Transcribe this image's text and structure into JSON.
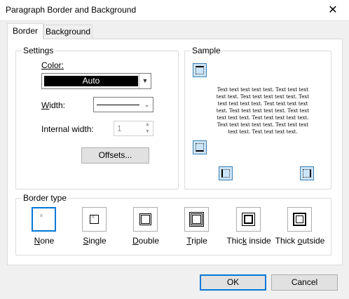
{
  "window": {
    "title": "Paragraph Border and Background",
    "close_glyph": "✕"
  },
  "tabs": [
    {
      "label": "Border",
      "active": true
    },
    {
      "label": "Background",
      "active": false
    }
  ],
  "settings": {
    "group_label": "Settings",
    "color_label": "Color:",
    "color_value": "Auto",
    "width_label": "Width:",
    "internal_width_label": "Internal width:",
    "internal_width_value": "1",
    "offsets_label": "Offsets..."
  },
  "sample": {
    "group_label": "Sample",
    "text": "Text text text text text. Text text text text text. Text text text text text. Text text text text text. Text text text text text. Text text text text text. Text text text text text. Text text text text text. Text text text text text. Text text text text text. Text text text text."
  },
  "border_type": {
    "group_label": "Border type",
    "options": [
      {
        "label": "None",
        "selected": true
      },
      {
        "label": "Single",
        "selected": false
      },
      {
        "label": "Double",
        "selected": false
      },
      {
        "label": "Triple",
        "selected": false
      },
      {
        "label": "Thick inside",
        "selected": false
      },
      {
        "label": "Thick outside",
        "selected": false
      }
    ]
  },
  "footer": {
    "ok_label": "OK",
    "cancel_label": "Cancel"
  },
  "colors": {
    "accent": "#0078d7",
    "swatch": "#000000",
    "sample_button_fill": "#cce4f7"
  }
}
